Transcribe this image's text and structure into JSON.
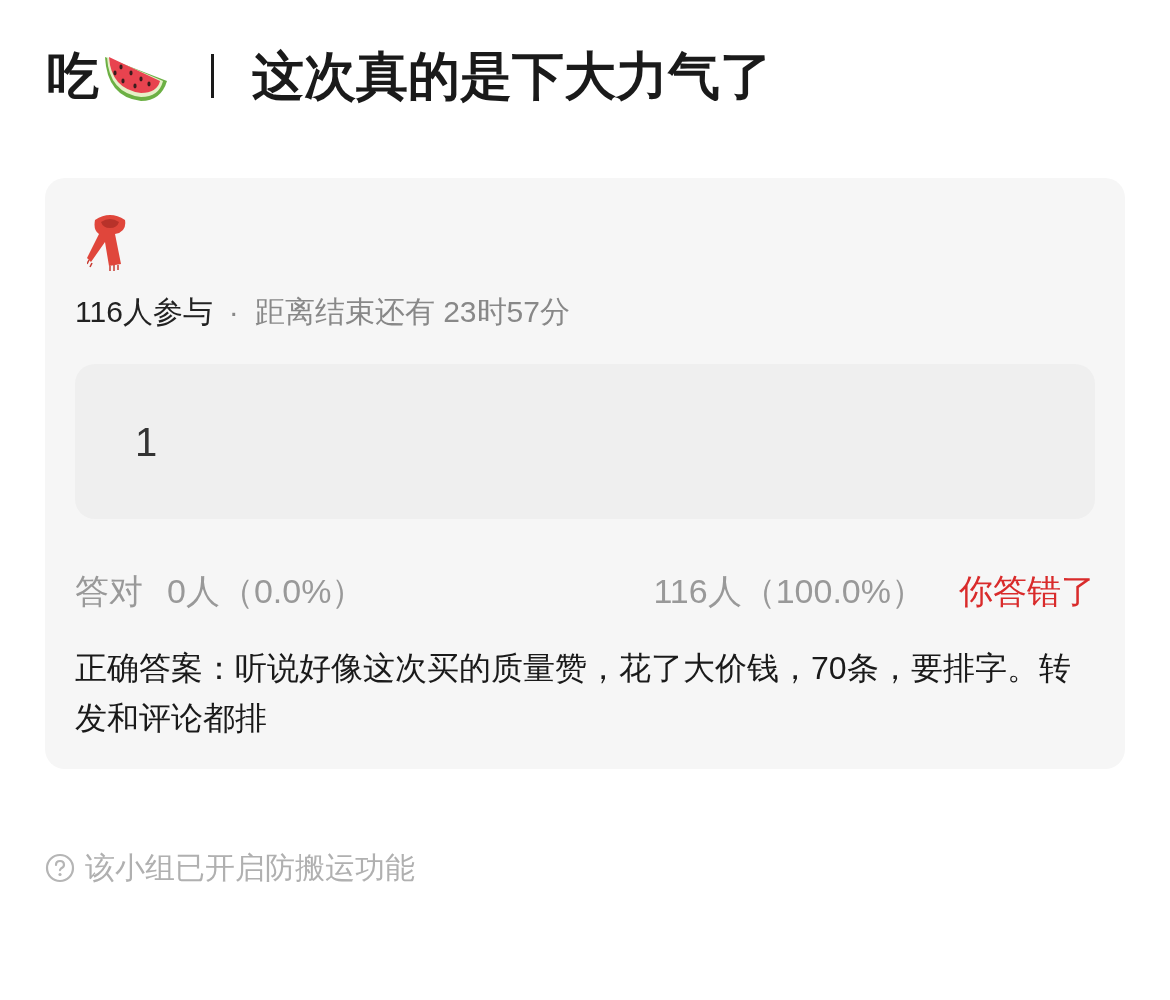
{
  "header": {
    "prefix": "吃",
    "title": "这次真的是下大力气了"
  },
  "quiz": {
    "participants": "116人参与",
    "separator": "·",
    "countdown": "距离结束还有 23时57分",
    "options": [
      {
        "label": "1"
      }
    ],
    "stats": {
      "correct_label": "答对",
      "correct_count": "0人（0.0%）",
      "wrong_count": "116人（100.0%）"
    },
    "result": {
      "kind": "wrong",
      "label": "你答错了"
    },
    "answer": "正确答案：听说好像这次买的质量赞，花了大价钱，70条，要排字。转发和评论都排"
  },
  "footer": {
    "notice": "该小组已开启防搬运功能"
  }
}
